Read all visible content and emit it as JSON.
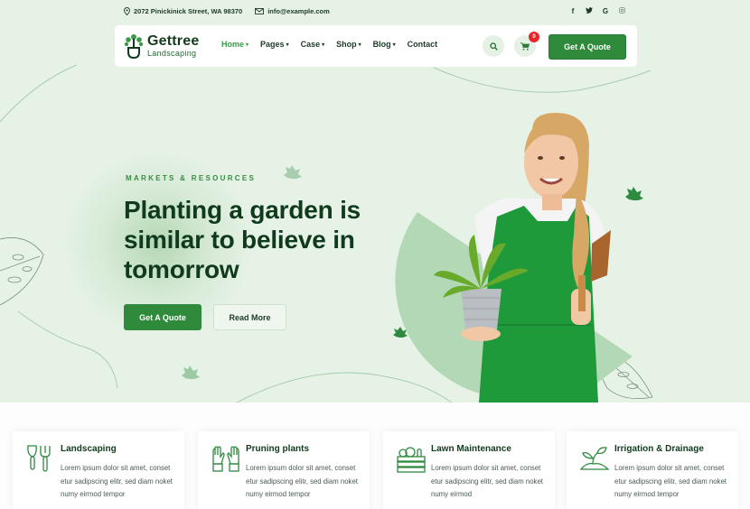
{
  "topbar": {
    "address": "2072 Pinickinick Street, WA 98370",
    "email": "info@example.com",
    "social": [
      {
        "icon": "facebook-icon",
        "glyph": "f"
      },
      {
        "icon": "twitter-icon",
        "glyph": "🐦"
      },
      {
        "icon": "google-icon",
        "glyph": "G"
      },
      {
        "icon": "instagram-icon",
        "glyph": "◎"
      }
    ]
  },
  "nav": {
    "logo_title": "Gettree",
    "logo_subtitle": "Landscaping",
    "menu": [
      {
        "label": "Home",
        "active": true,
        "dropdown": true
      },
      {
        "label": "Pages",
        "active": false,
        "dropdown": true
      },
      {
        "label": "Case",
        "active": false,
        "dropdown": true
      },
      {
        "label": "Shop",
        "active": false,
        "dropdown": true
      },
      {
        "label": "Blog",
        "active": false,
        "dropdown": true
      },
      {
        "label": "Contact",
        "active": false,
        "dropdown": false
      }
    ],
    "chevron": "⌄",
    "cart_count": "0",
    "quote_label": "Get A Quote"
  },
  "hero": {
    "eyebrow": "MARKETS & RESOURCES",
    "headline": "Planting a garden is similar to believe in tomorrow",
    "primary_button": "Get A Quote",
    "secondary_button": "Read More"
  },
  "services": [
    {
      "icon": "garden-tools-icon",
      "title": "Landscaping",
      "text": "Lorem ipsum dolor sit amet, conset etur sadipscing elitr, sed diam noket numy eirmod tempor"
    },
    {
      "icon": "gloves-icon",
      "title": "Pruning plants",
      "text": "Lorem ipsum dolor sit amet, conset etur sadipscing elitr, sed diam noket numy eirmod tempor"
    },
    {
      "icon": "vegetable-crate-icon",
      "title": "Lawn Maintenance",
      "text": "Lorem ipsum dolor sit amet, conset etur sadipscing elitr, sed diam noket numy eirmod"
    },
    {
      "icon": "sprout-icon",
      "title": "Irrigation & Drainage",
      "text": "Lorem ipsum dolor sit amet, conset etur sadipscing elitr, sed diam noket numy eirmod tempor"
    }
  ],
  "colors": {
    "brand_green": "#2f8a3b",
    "dark_green": "#103a1e",
    "hero_bg": "#e6f2e6",
    "badge_red": "#e8262a"
  }
}
